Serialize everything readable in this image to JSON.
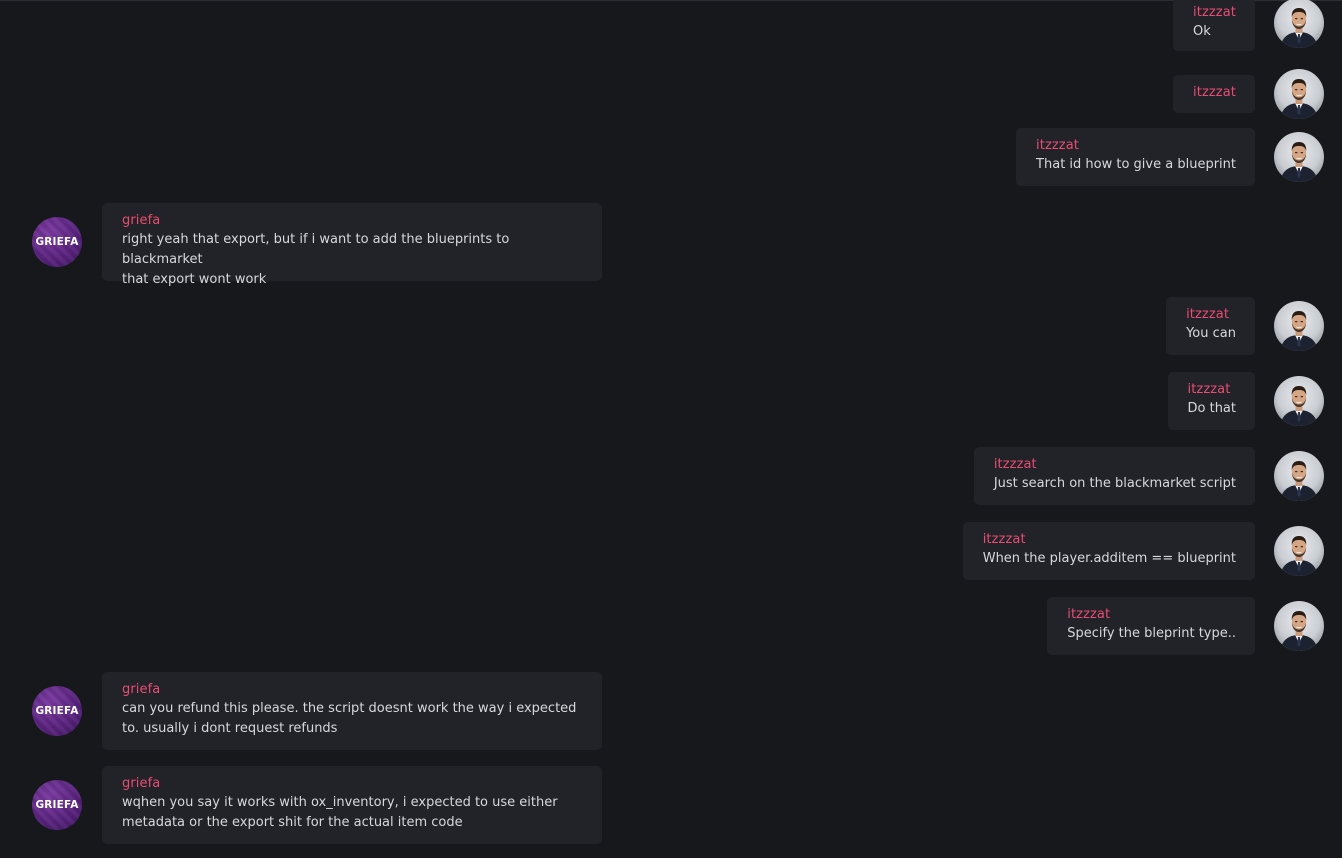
{
  "messages": [
    {
      "author": "itzzzat",
      "text": "Ok"
    },
    {
      "author": "itzzzat",
      "text": ""
    },
    {
      "author": "itzzzat",
      "text": "That id how to give a blueprint"
    },
    {
      "author": "griefa",
      "text": "right yeah that export, but if i want to add the blueprints to blackmarket\nthat export wont work"
    },
    {
      "author": "itzzzat",
      "text": "You can"
    },
    {
      "author": "itzzzat",
      "text": "Do that"
    },
    {
      "author": "itzzzat",
      "text": "Just search on the blackmarket script"
    },
    {
      "author": "itzzzat",
      "text": "When the player.additem == blueprint"
    },
    {
      "author": "itzzzat",
      "text": "Specify the bleprint type.."
    },
    {
      "author": "griefa",
      "text": "can you refund this please. the script doesnt work the way i expected\nto. usually i dont request refunds"
    },
    {
      "author": "griefa",
      "text": "wqhen you say it works with ox_inventory, i expected to use either\nmetadata or the export shit for the actual item code"
    }
  ],
  "avatars": {
    "griefa_label": "GRIEFA",
    "itzzzat_icon": "profile-photo"
  },
  "colors": {
    "background": "#16181c",
    "bubble": "#212328",
    "author": "#ea4c72",
    "text": "#d6d8dc",
    "griefa_avatar": "#5a237e"
  }
}
